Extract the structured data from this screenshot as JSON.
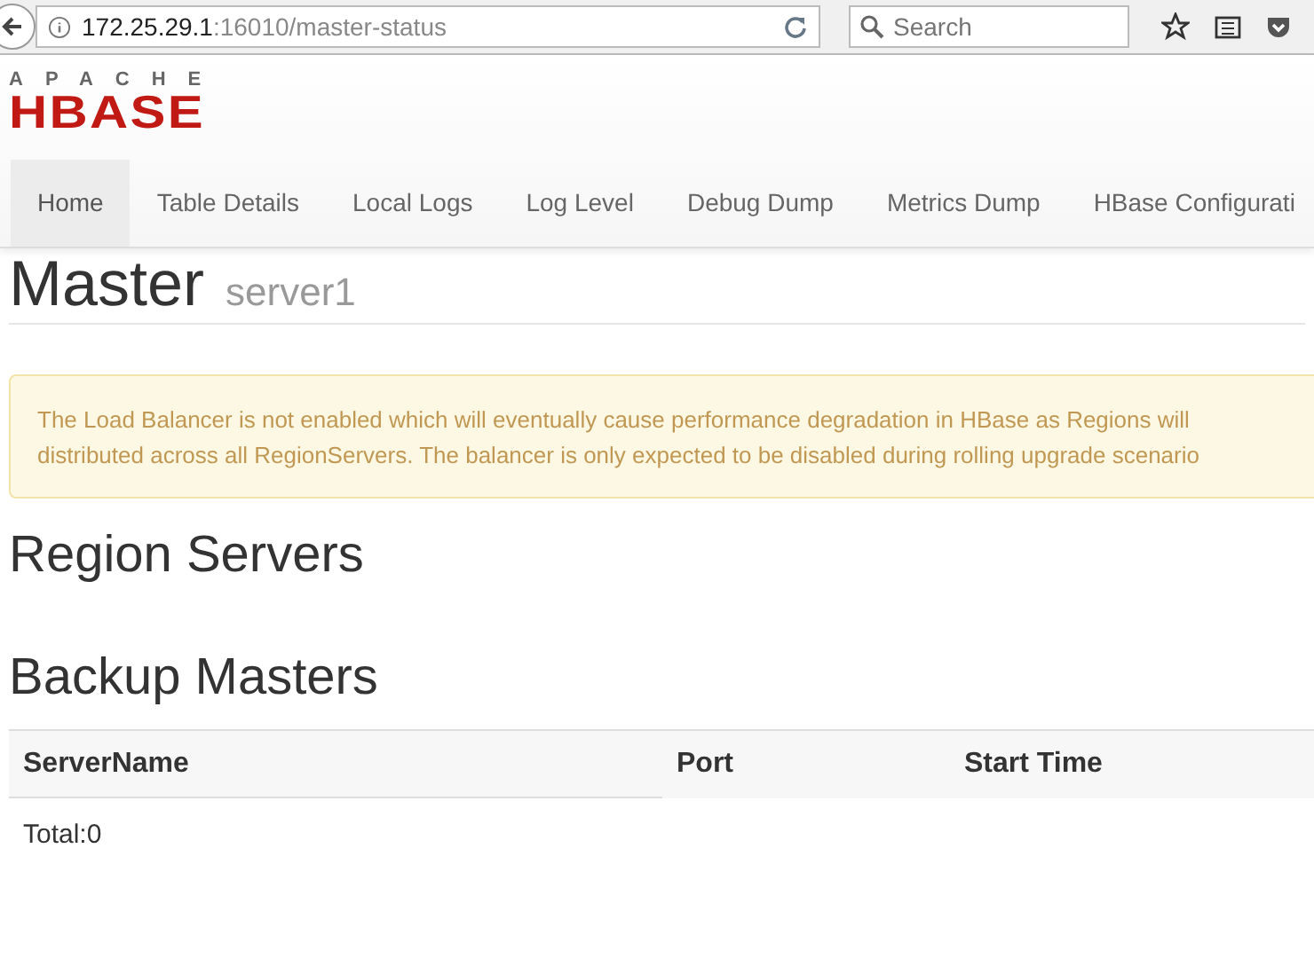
{
  "browser": {
    "url_host": "172.25.29.1",
    "url_path": ":16010/master-status",
    "search_placeholder": "Search"
  },
  "logo": {
    "top": "APACHE",
    "main": "HBASE"
  },
  "nav": [
    {
      "label": "Home",
      "selected": true
    },
    {
      "label": "Table Details",
      "selected": false
    },
    {
      "label": "Local Logs",
      "selected": false
    },
    {
      "label": "Log Level",
      "selected": false
    },
    {
      "label": "Debug Dump",
      "selected": false
    },
    {
      "label": "Metrics Dump",
      "selected": false
    },
    {
      "label": "HBase Configurati",
      "selected": false
    }
  ],
  "page_title": {
    "title": "Master",
    "subtitle": "server1"
  },
  "alert": {
    "lines": [
      "The Load Balancer is not enabled which will eventually cause performance degradation in HBase as Regions will",
      "distributed across all RegionServers. The balancer is only expected to be disabled during rolling upgrade scenario"
    ]
  },
  "sections": [
    {
      "heading": "Region Servers"
    },
    {
      "heading": "Backup Masters"
    }
  ],
  "table": {
    "columns": [
      "ServerName",
      "Port",
      "Start Time"
    ],
    "footer": "Total:0"
  }
}
